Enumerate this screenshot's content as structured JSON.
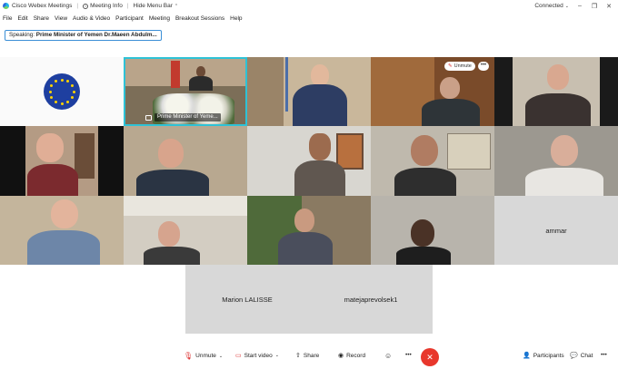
{
  "app": {
    "title": "Cisco Webex Meetings",
    "meeting_info": "Meeting Info",
    "hide_menu": "Hide Menu Bar",
    "status": "Connected",
    "win_min": "–",
    "win_max": "❐",
    "win_close": "✕",
    "chevron": "⌄"
  },
  "menu": [
    "File",
    "Edit",
    "Share",
    "View",
    "Audio & Video",
    "Participant",
    "Meeting",
    "Breakout Sessions",
    "Help"
  ],
  "speaking": {
    "prefix": "Speaking:",
    "name": "Prime Minister of Yemen Dr.Maeen Abdulm..."
  },
  "tiles": {
    "active_name": "Prime Minister of Yeme...",
    "ammar": "ammar",
    "marion": "Marion LALISSE",
    "mateja": "matejaprevolsek1"
  },
  "tile_controls": {
    "unmute": "Unmute",
    "more": "•••"
  },
  "controls": {
    "unmute": "Unmute",
    "start_video": "Start video",
    "share": "Share",
    "record": "Record",
    "reactions": "☺",
    "more": "•••",
    "end": "✕",
    "participants": "Participants",
    "chat": "Chat",
    "overflow": "•••"
  },
  "colors": {
    "accent": "#3c8fd6",
    "active_border": "#2ec2d6",
    "end_call": "#e8372c",
    "eu_blue": "#1e3fa0",
    "eu_star": "#ffd400"
  }
}
